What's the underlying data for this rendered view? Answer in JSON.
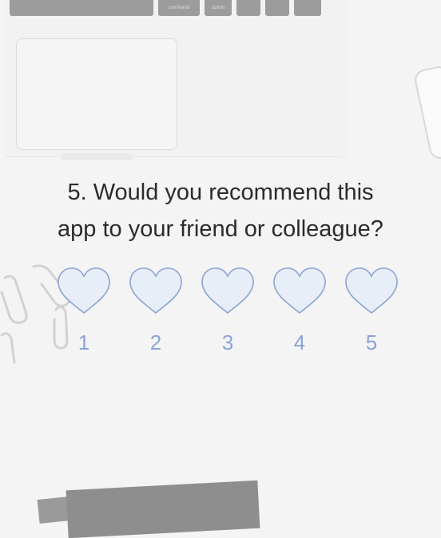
{
  "laptop": {
    "keys": [
      "",
      "command",
      "option",
      "",
      "",
      ""
    ]
  },
  "question": {
    "line1": "5. Would you recommend this",
    "line2": "app to your friend or colleague?"
  },
  "rating": {
    "options": [
      "1",
      "2",
      "3",
      "4",
      "5"
    ],
    "icon": "heart-icon",
    "accent": "#8aa4d6",
    "fill": "#e8eef8"
  }
}
